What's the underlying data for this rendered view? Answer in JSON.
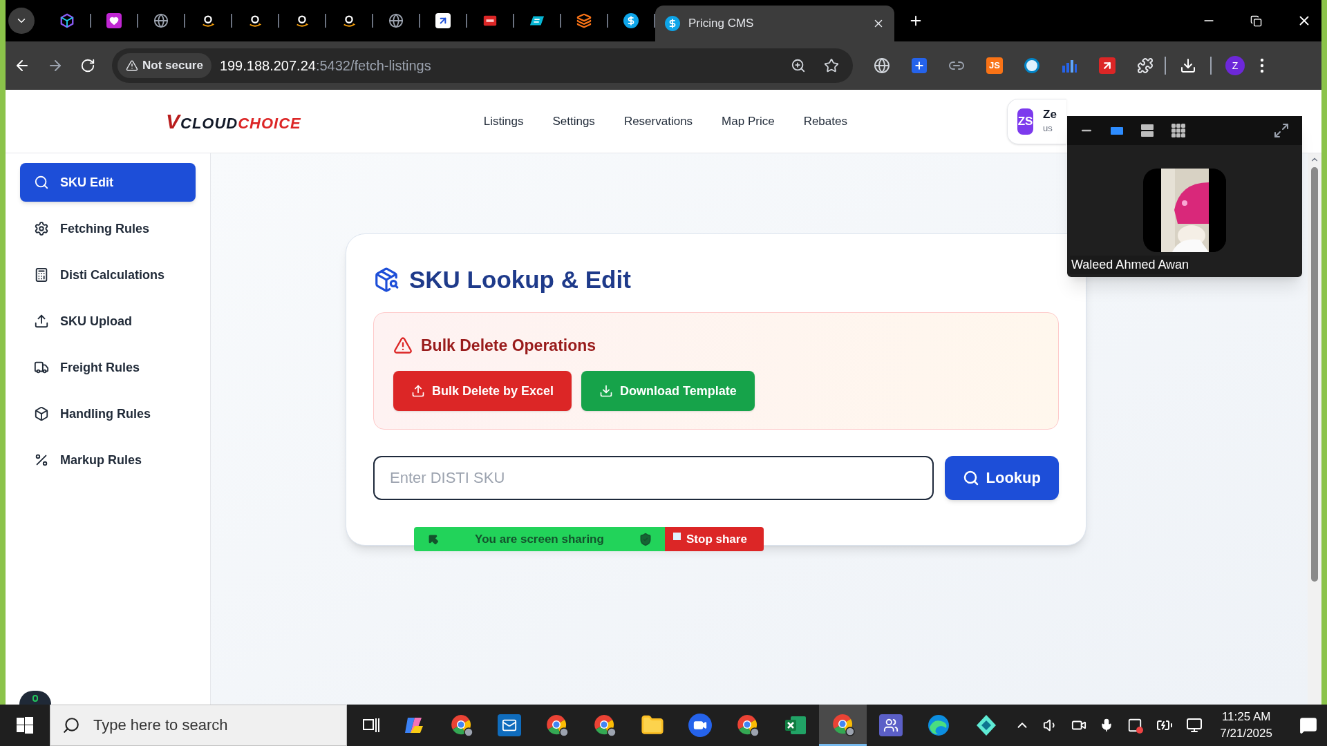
{
  "browser": {
    "tabs": [
      {
        "kind": "cube",
        "selected": false
      },
      {
        "kind": "heart",
        "selected": false
      },
      {
        "kind": "globe",
        "selected": false
      },
      {
        "kind": "smile",
        "selected": false
      },
      {
        "kind": "smile",
        "selected": false
      },
      {
        "kind": "smile",
        "selected": false
      },
      {
        "kind": "smile",
        "selected": false
      },
      {
        "kind": "globe",
        "selected": false
      },
      {
        "kind": "square-arrow",
        "selected": false
      },
      {
        "kind": "tag",
        "selected": false
      },
      {
        "kind": "parallelogram",
        "selected": false
      },
      {
        "kind": "layers",
        "selected": false
      },
      {
        "kind": "dollar",
        "selected": false
      },
      {
        "kind": "dollar",
        "title": "Pricing CMS",
        "selected": true
      }
    ],
    "security": "Not secure",
    "url_host": "199.188.207.24",
    "url_path": ":5432/fetch-listings",
    "profile": "Z",
    "extensions": [
      {
        "kind": "globe"
      },
      {
        "kind": "plus"
      },
      {
        "kind": "link"
      },
      {
        "kind": "badge",
        "text": "JS"
      },
      {
        "kind": "circle"
      },
      {
        "kind": "bars"
      },
      {
        "kind": "arrow"
      },
      {
        "kind": "puzzle"
      }
    ]
  },
  "header": {
    "logo": {
      "mark": "V",
      "part_1": "CLOUD",
      "part_2": "CHOICE"
    },
    "nav": [
      "Listings",
      "Settings",
      "Reservations",
      "Map Price",
      "Rebates"
    ],
    "user": {
      "initials": "ZS",
      "name": "Ze",
      "role": "us"
    }
  },
  "sidebar": {
    "items": [
      {
        "label": "SKU Edit",
        "kind": "search",
        "selected": true
      },
      {
        "label": "Fetching Rules",
        "kind": "gear",
        "selected": false
      },
      {
        "label": "Disti Calculations",
        "kind": "calculator",
        "selected": false
      },
      {
        "label": "SKU Upload",
        "kind": "upload",
        "selected": false
      },
      {
        "label": "Freight Rules",
        "kind": "truck",
        "selected": false
      },
      {
        "label": "Handling Rules",
        "kind": "box",
        "selected": false
      },
      {
        "label": "Markup Rules",
        "kind": "percent",
        "selected": false
      }
    ]
  },
  "lookup": {
    "title": "SKU Lookup & Edit",
    "bulk": {
      "title": "Bulk Delete Operations",
      "buttons": [
        {
          "label": "Bulk Delete by Excel",
          "kind": "danger"
        },
        {
          "label": "Download Template",
          "kind": "success"
        }
      ]
    },
    "input": {
      "placeholder": "Enter DISTI SKU"
    },
    "button": "Lookup"
  },
  "share_bar": {
    "message": "You are screen sharing",
    "stop": "Stop share"
  },
  "video": {
    "views": [
      {
        "kind": "speaker",
        "selected": true
      },
      {
        "kind": "strip",
        "selected": false
      },
      {
        "kind": "gallery",
        "selected": false
      }
    ],
    "participant": "Waleed Ahmed Awan"
  },
  "taskbar": {
    "search_placeholder": "Type here to search",
    "apps": [
      {
        "kind": "swirl",
        "selected": false
      },
      {
        "kind": "tricolor",
        "selected": false
      },
      {
        "kind": "mail",
        "selected": false
      },
      {
        "kind": "tricolor",
        "selected": false
      },
      {
        "kind": "tricolor",
        "selected": false
      },
      {
        "kind": "folder",
        "selected": false
      },
      {
        "kind": "video",
        "selected": false
      },
      {
        "kind": "tricolor",
        "selected": false
      },
      {
        "kind": "sheet",
        "selected": false
      },
      {
        "kind": "tricolor",
        "selected": true
      },
      {
        "kind": "people",
        "selected": false
      },
      {
        "kind": "wave",
        "selected": false
      },
      {
        "kind": "diamond",
        "selected": false
      }
    ],
    "time": "11:25 AM",
    "date": "7/21/2025"
  }
}
